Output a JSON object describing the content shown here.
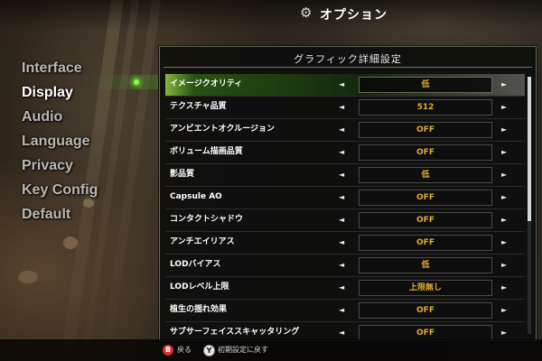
{
  "header": {
    "title": "オプション",
    "icon": "gear-icon"
  },
  "side_menu": {
    "items": [
      {
        "label": "Interface"
      },
      {
        "label": "Display"
      },
      {
        "label": "Audio"
      },
      {
        "label": "Language"
      },
      {
        "label": "Privacy"
      },
      {
        "label": "Key Config"
      },
      {
        "label": "Default"
      }
    ],
    "active": "Display"
  },
  "panel": {
    "title": "グラフィック詳細設定",
    "settings": [
      {
        "label": "イメージクオリティ",
        "value": "低"
      },
      {
        "label": "テクスチャ品質",
        "value": "512"
      },
      {
        "label": "アンビエントオクルージョン",
        "value": "OFF"
      },
      {
        "label": "ボリューム描画品質",
        "value": "OFF"
      },
      {
        "label": "影品質",
        "value": "低"
      },
      {
        "label": "Capsule AO",
        "value": "OFF"
      },
      {
        "label": "コンタクトシャドウ",
        "value": "OFF"
      },
      {
        "label": "アンチエイリアス",
        "value": "OFF"
      },
      {
        "label": "LODバイアス",
        "value": "低"
      },
      {
        "label": "LODレベル上限",
        "value": "上限無し"
      },
      {
        "label": "植生の揺れ効果",
        "value": "OFF"
      },
      {
        "label": "サブサーフェイススキャッタリング",
        "value": "OFF"
      }
    ],
    "arrow_left": "◄",
    "arrow_right": "►"
  },
  "footer": {
    "back_button_glyph": "B",
    "back_label": "戻る",
    "reset_button_glyph": "Y",
    "reset_label": "初期設定に戻す"
  },
  "colors": {
    "accent_green": "#8aff3c",
    "value_text": "#e3ad2a"
  }
}
